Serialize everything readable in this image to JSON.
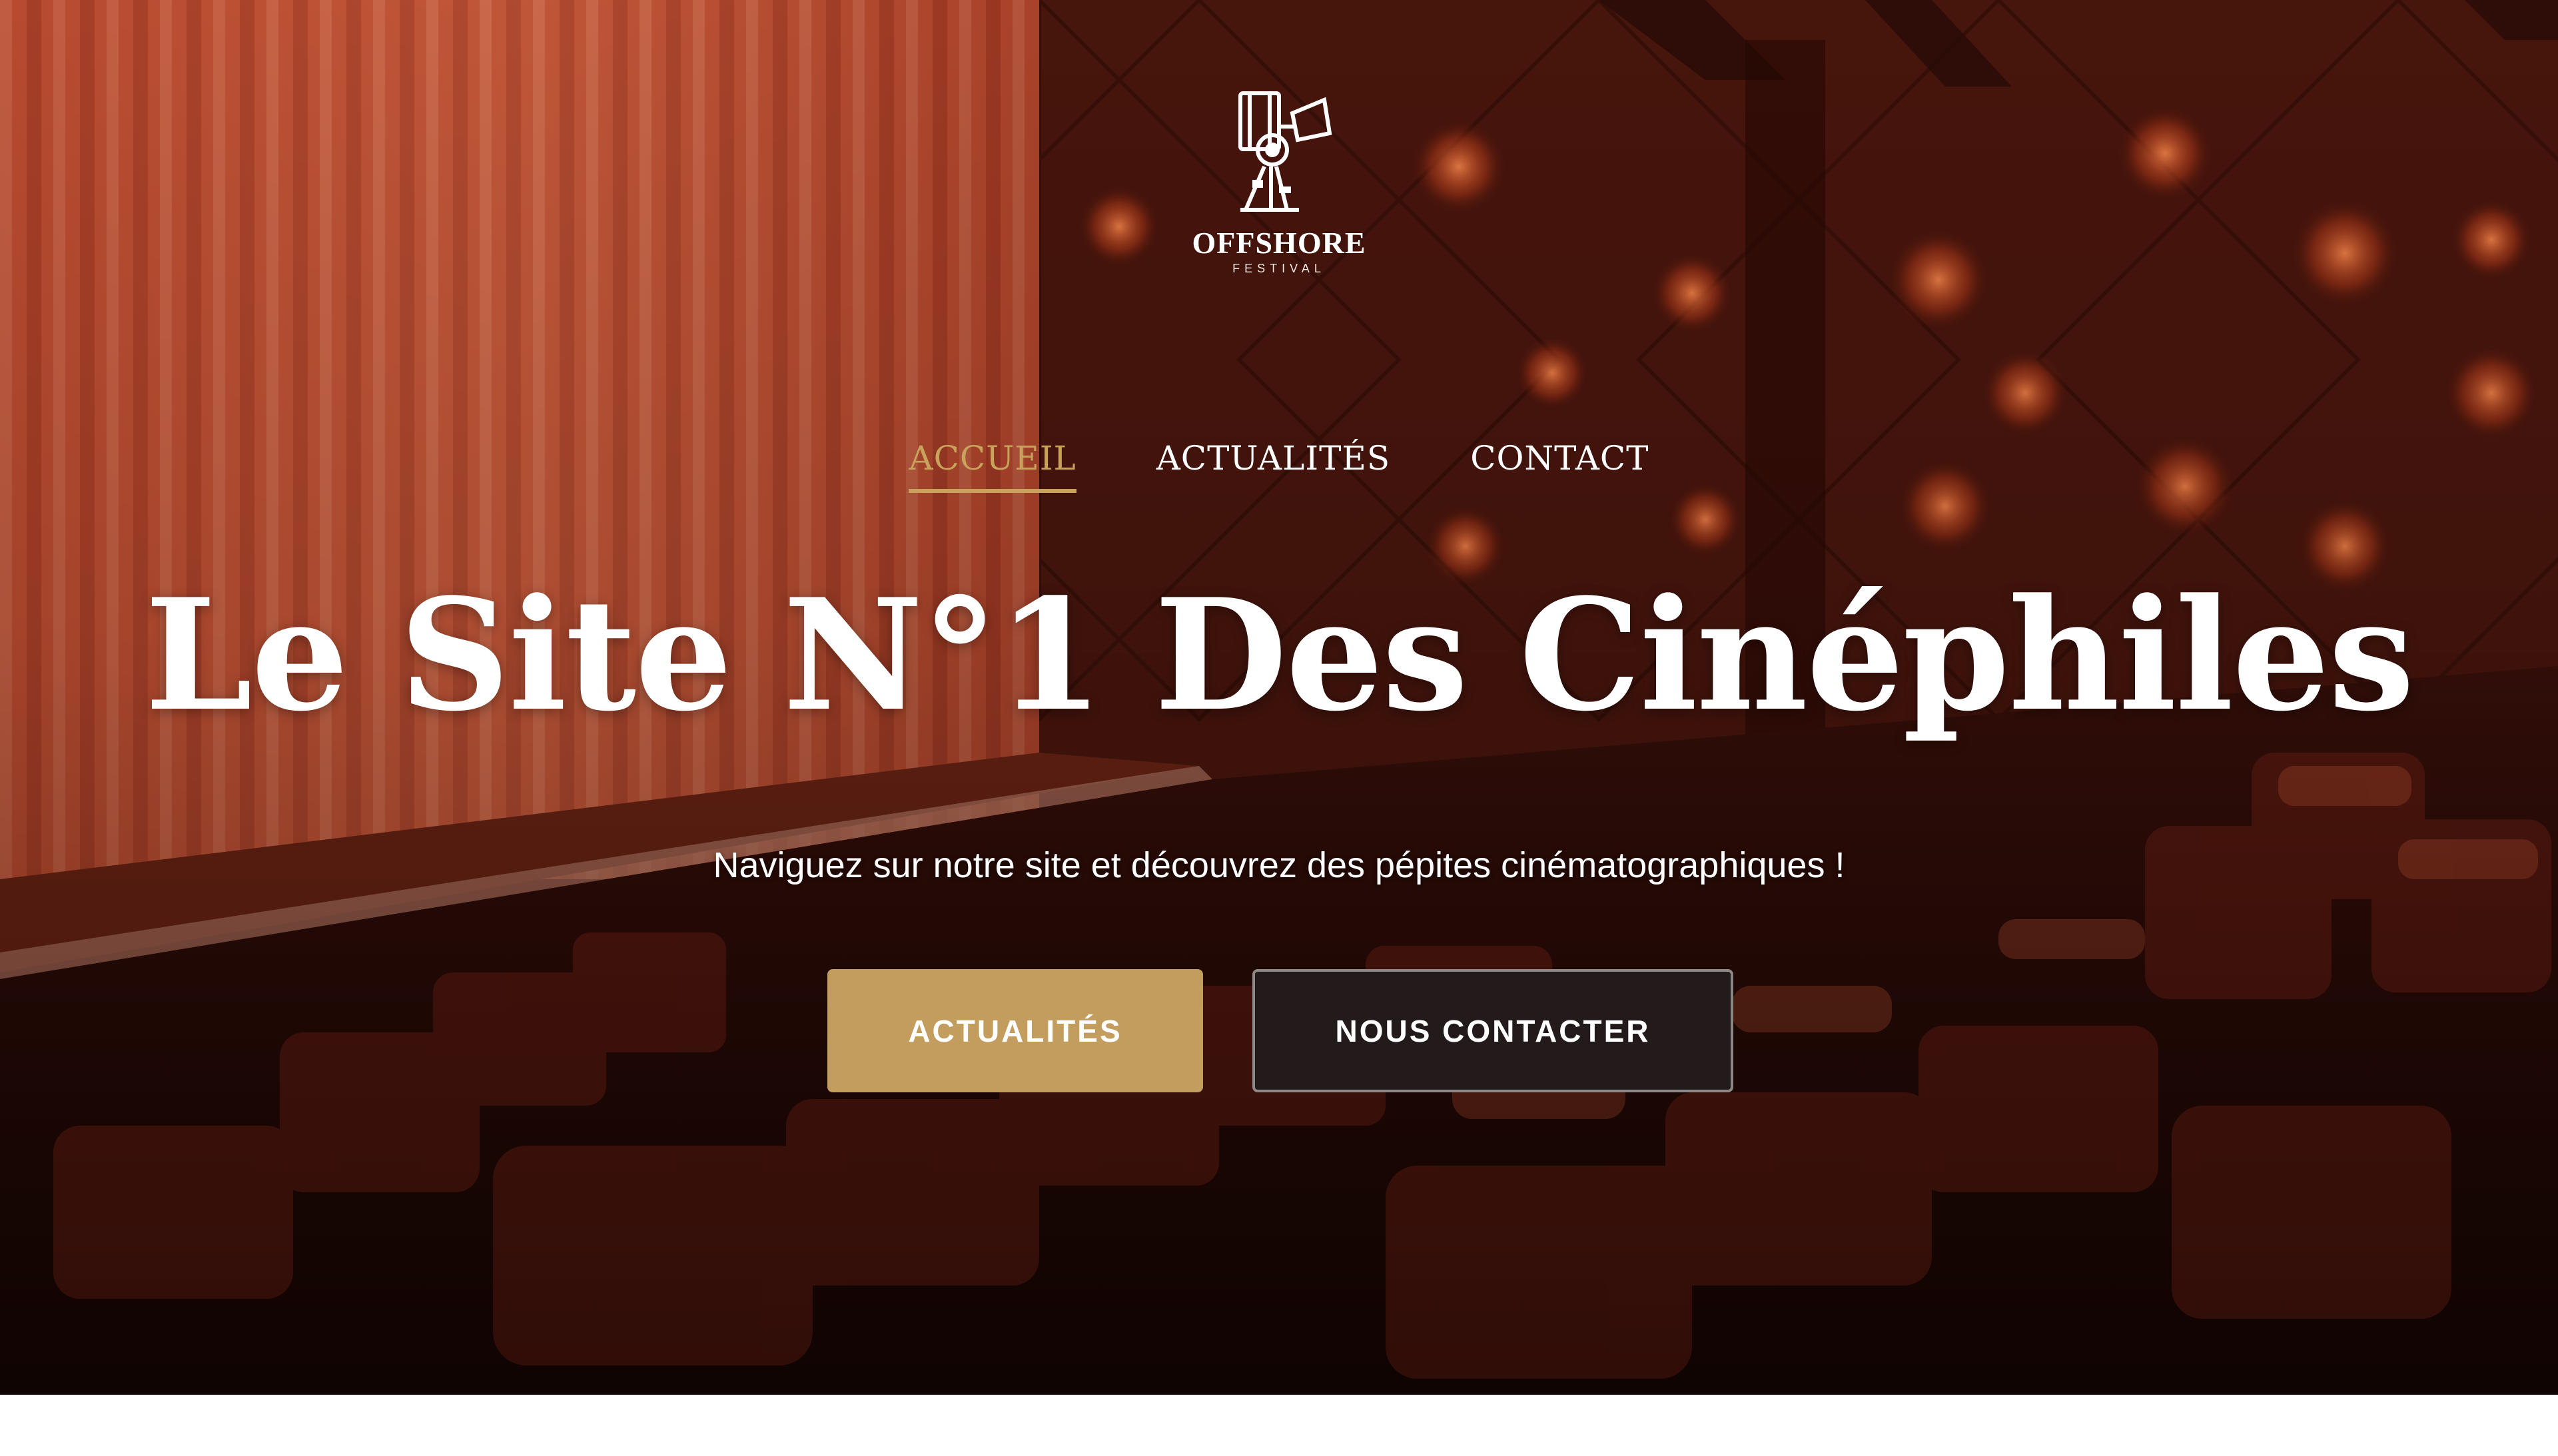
{
  "logo": {
    "name": "OFFSHORE",
    "subtitle": "FESTIVAL"
  },
  "nav": {
    "items": [
      {
        "label": "ACCUEIL",
        "active": true
      },
      {
        "label": "ACTUALITÉS",
        "active": false
      },
      {
        "label": "CONTACT",
        "active": false
      }
    ]
  },
  "hero": {
    "title": "Le Site N°1 Des Cinéphiles",
    "subtitle": "Naviguez sur notre site et découvrez des pépites cinématographiques !",
    "primary_button": "ACTUALITÉS",
    "secondary_button": "NOUS CONTACTER"
  },
  "colors": {
    "accent": "#c9a25c",
    "primary_button": "#c39d5e",
    "secondary_button": "#231b1b",
    "curtain": "#c0452a"
  },
  "icons": {
    "logo": "film-projector-logo-icon"
  }
}
